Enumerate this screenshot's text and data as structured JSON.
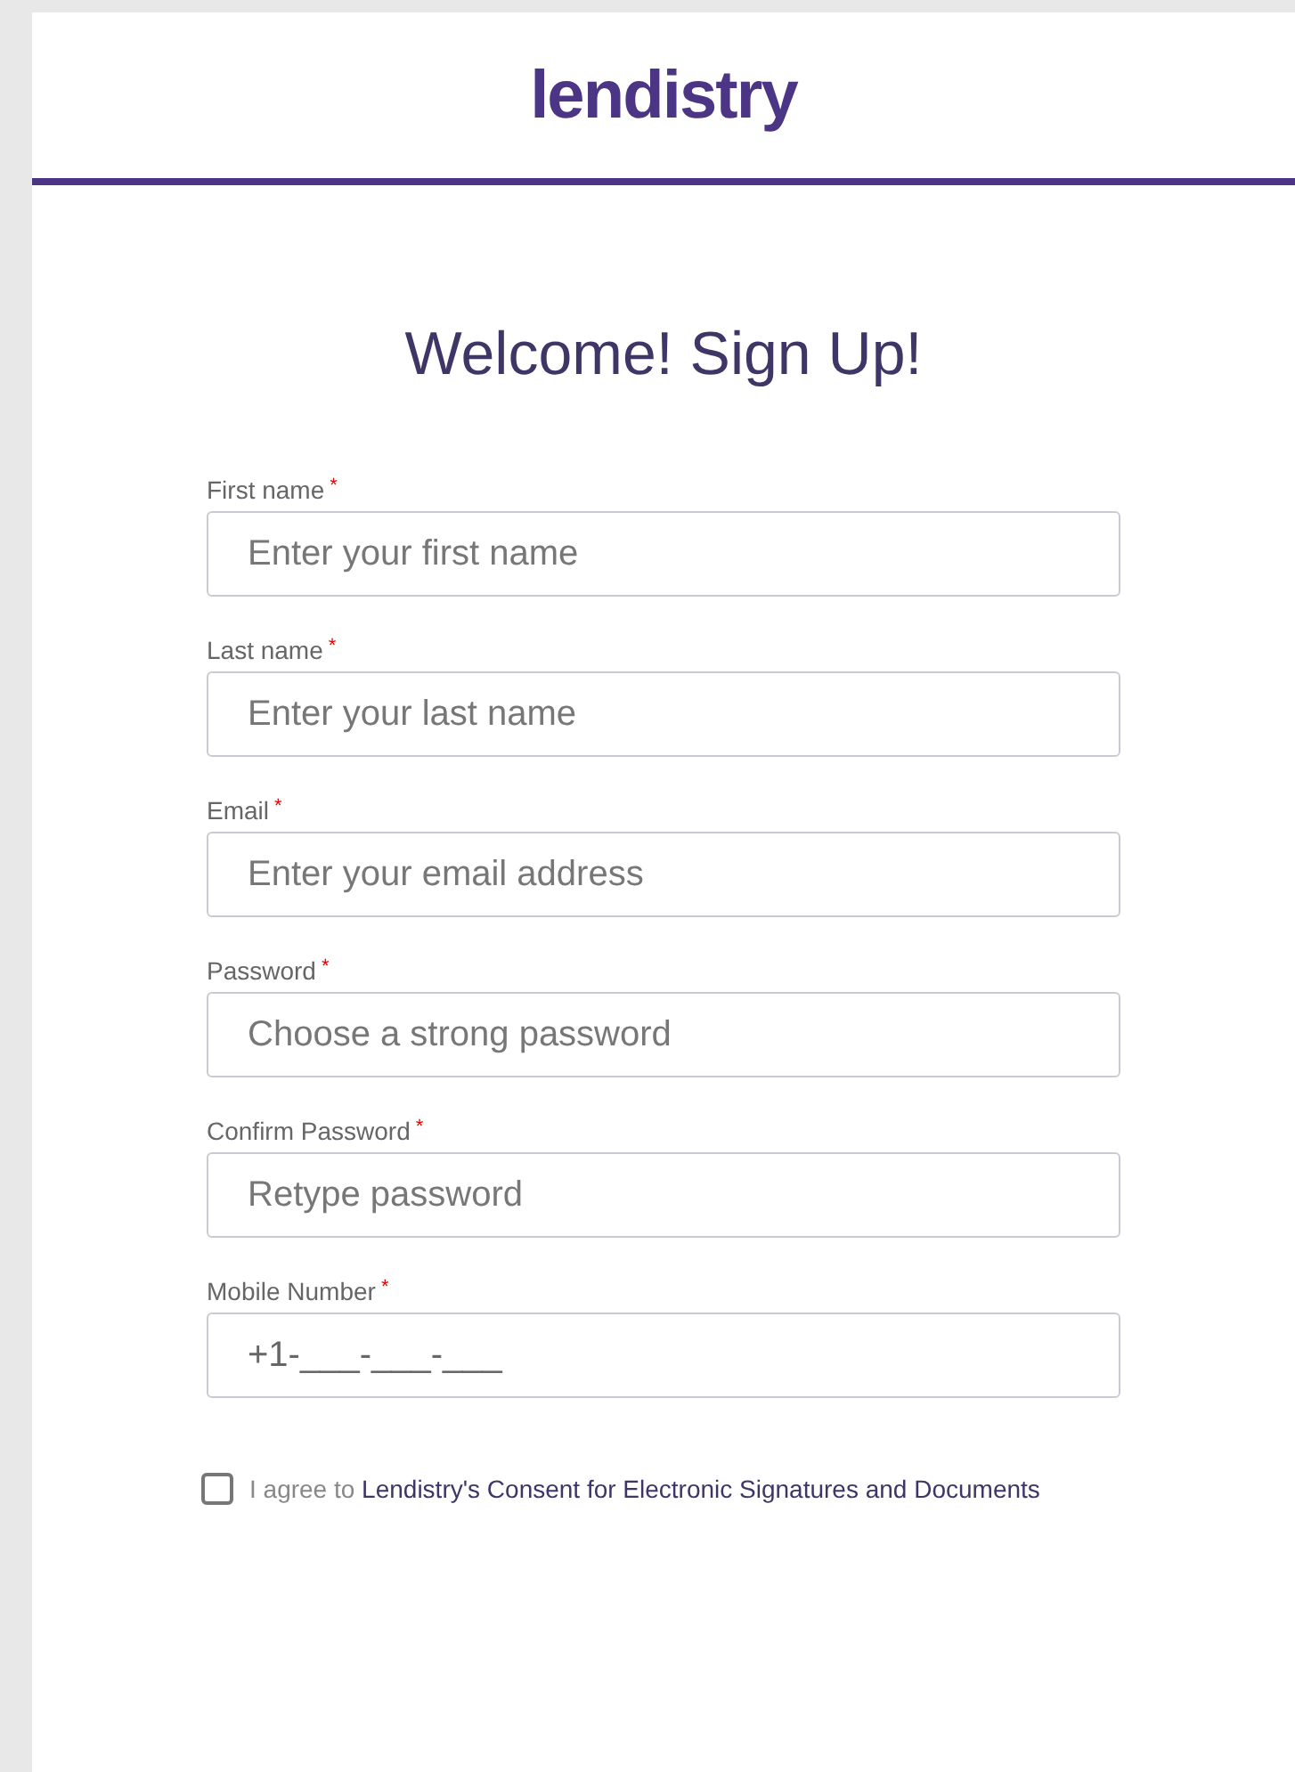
{
  "logo": {
    "text": "lendistry"
  },
  "title": "Welcome! Sign Up!",
  "fields": [
    {
      "label": "First name",
      "required_mark": "*",
      "placeholder": "Enter your first name"
    },
    {
      "label": "Last name",
      "required_mark": "*",
      "placeholder": "Enter your last name"
    },
    {
      "label": "Email",
      "required_mark": "*",
      "placeholder": "Enter your email address"
    },
    {
      "label": "Password",
      "required_mark": "*",
      "placeholder": "Choose a strong password"
    },
    {
      "label": "Confirm Password",
      "required_mark": "*",
      "placeholder": "Retype password"
    },
    {
      "label": "Mobile Number",
      "required_mark": "*",
      "value": "+1-___-___-___"
    }
  ],
  "consent": {
    "checked": false,
    "text": "I agree to",
    "link": "Lendistry's Consent for Electronic Signatures and Documents"
  }
}
